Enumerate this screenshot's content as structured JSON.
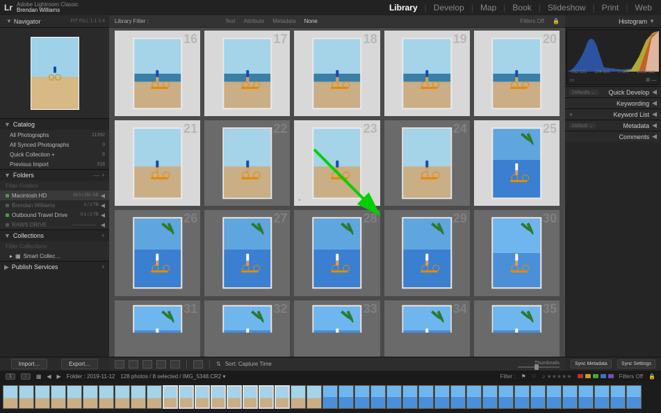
{
  "app": {
    "product": "Adobe Lightroom Classic",
    "user": "Brendan Williams",
    "logo": "Lr"
  },
  "modules": [
    "Library",
    "Develop",
    "Map",
    "Book",
    "Slideshow",
    "Print",
    "Web"
  ],
  "active_module": "Library",
  "left": {
    "navigator": {
      "title": "Navigator",
      "zoom_opts": "FIT   FILL   1:1   1:4"
    },
    "catalog": {
      "title": "Catalog",
      "rows": [
        {
          "label": "All Photographs",
          "count": "11392"
        },
        {
          "label": "All Synced Photographs",
          "count": "0"
        },
        {
          "label": "Quick Collection +",
          "count": "8"
        },
        {
          "label": "Previous Import",
          "count": "318"
        }
      ]
    },
    "folders": {
      "title": "Folders",
      "filter_placeholder": "Filter Folders",
      "drives": [
        {
          "bullet": "green",
          "name": "Macintosh HD",
          "usage": "18.0 / 251 GB",
          "fill": 62,
          "arrow": true
        },
        {
          "bullet": "gray",
          "name": "Brendan Williams",
          "usage": "0 / 2 TB",
          "fill": 0,
          "arrow": true,
          "muted": true
        },
        {
          "bullet": "green",
          "name": "Outbound Travel Drive",
          "usage": "0.1 / 2 TB",
          "fill": 3,
          "arrow": true
        },
        {
          "bullet": "gray",
          "name": "RAWS DRIVE",
          "usage": "",
          "fill": 0,
          "arrow": true,
          "muted": true
        }
      ]
    },
    "collections": {
      "title": "Collections",
      "filter_placeholder": "Filter Collections",
      "items": [
        {
          "label": "Smart Collec…"
        }
      ]
    },
    "publish": {
      "title": "Publish Services"
    },
    "import_btn": "Import…",
    "export_btn": "Export…"
  },
  "right": {
    "histogram": {
      "title": "Histogram",
      "meta": [
        "ISO 125",
        "104 mm",
        "f / 8.0",
        "1/250 sec"
      ]
    },
    "panels": [
      {
        "label": "Quick Develop",
        "tag": "Defaults"
      },
      {
        "label": "Keywording"
      },
      {
        "label": "Keyword List",
        "plus": true
      },
      {
        "label": "Metadata",
        "tag": "Default"
      },
      {
        "label": "Comments"
      }
    ],
    "sync_meta": "Sync Metadata",
    "sync_settings": "Sync Settings"
  },
  "filter": {
    "label": "Library Filter :",
    "opts": [
      "Text",
      "Attribute",
      "Metadata",
      "None"
    ],
    "active": "None",
    "state": "Filters Off"
  },
  "grid": {
    "rows": [
      [
        {
          "n": 16,
          "v": "beach",
          "sel": true
        },
        {
          "n": 17,
          "v": "beach",
          "sel": true
        },
        {
          "n": 18,
          "v": "beach",
          "sel": true
        },
        {
          "n": 19,
          "v": "beach",
          "sel": true
        },
        {
          "n": 20,
          "v": "beach",
          "sel": true
        }
      ],
      [
        {
          "n": 21,
          "v": "beach2",
          "sel": true
        },
        {
          "n": 22,
          "v": "beach2",
          "sel": false
        },
        {
          "n": 23,
          "v": "beach2",
          "sel": true,
          "star": true
        },
        {
          "n": 24,
          "v": "beach2",
          "sel": false
        },
        {
          "n": 25,
          "v": "palm",
          "sel": true
        }
      ],
      [
        {
          "n": 26,
          "v": "palm",
          "sel": false
        },
        {
          "n": 27,
          "v": "palm",
          "sel": false
        },
        {
          "n": 28,
          "v": "palm",
          "sel": false
        },
        {
          "n": 29,
          "v": "palm",
          "sel": false
        },
        {
          "n": 30,
          "v": "palm2",
          "sel": false
        }
      ],
      [
        {
          "n": 31,
          "v": "palm2",
          "sel": false
        },
        {
          "n": 32,
          "v": "palm2",
          "sel": false
        },
        {
          "n": 33,
          "v": "palm2",
          "sel": false
        },
        {
          "n": 34,
          "v": "palm2",
          "sel": false
        },
        {
          "n": 35,
          "v": "palm2",
          "sel": false
        }
      ]
    ]
  },
  "toolbar": {
    "sort_label": "Sort:",
    "sort_value": "Capture Time",
    "thumb_label": "Thumbnails"
  },
  "status": {
    "path": "Folder : 2019-11-12",
    "count": "128 photos / 8 selected / IMG_5348.CR2 ▾",
    "filter_label": "Filter :",
    "filters_off": "Filters Off",
    "colors": [
      "#c03030",
      "#c0a030",
      "#50a040",
      "#4070c0",
      "#7050b0"
    ]
  },
  "filmstrip": {
    "count": 40,
    "variants": [
      "beach",
      "beach",
      "beach",
      "beach",
      "beach",
      "beach",
      "beach",
      "beach",
      "beach",
      "beach",
      "beach",
      "beach",
      "beach",
      "beach",
      "beach",
      "beach",
      "beach",
      "beach",
      "beach",
      "beach",
      "palm",
      "palm",
      "palm",
      "palm",
      "palm",
      "palm",
      "palm",
      "palm",
      "palm",
      "palm",
      "palm",
      "palm",
      "palm",
      "palm",
      "palm",
      "palm",
      "palm",
      "palm",
      "palm",
      "palm"
    ],
    "sel_start": 10,
    "sel_end": 17
  }
}
